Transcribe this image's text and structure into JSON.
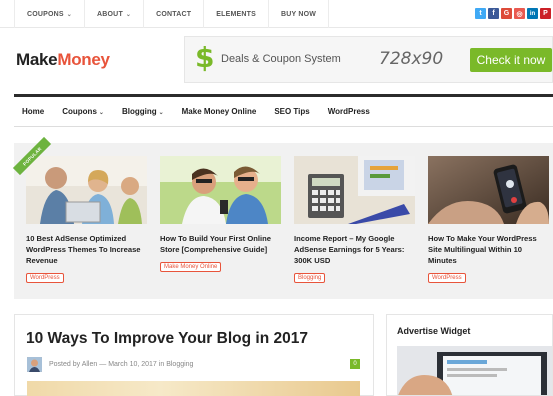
{
  "topbar": {
    "nav": [
      {
        "label": "COUPONS",
        "dropdown": true
      },
      {
        "label": "ABOUT",
        "dropdown": true
      },
      {
        "label": "CONTACT",
        "dropdown": false
      },
      {
        "label": "ELEMENTS",
        "dropdown": false
      },
      {
        "label": "BUY NOW",
        "dropdown": false
      }
    ],
    "social": [
      {
        "icon": "twitter-icon",
        "glyph": "t",
        "color": "#3fa9f5"
      },
      {
        "icon": "facebook-icon",
        "glyph": "f",
        "color": "#3b5998"
      },
      {
        "icon": "google-plus-icon",
        "glyph": "G",
        "color": "#dd4b39"
      },
      {
        "icon": "dribbble-icon",
        "glyph": "◎",
        "color": "#e95950"
      },
      {
        "icon": "linkedin-icon",
        "glyph": "in",
        "color": "#0077b5"
      },
      {
        "icon": "pinterest-icon",
        "glyph": "P",
        "color": "#cb2027"
      }
    ]
  },
  "header": {
    "logo_part1": "Make",
    "logo_part2": "Money",
    "ad": {
      "dollar": "$",
      "text": "Deals & Coupon System",
      "size": "728x90",
      "button": "Check it now"
    }
  },
  "main_nav": [
    {
      "label": "Home",
      "dropdown": false
    },
    {
      "label": "Coupons",
      "dropdown": true
    },
    {
      "label": "Blogging",
      "dropdown": true
    },
    {
      "label": "Make Money Online",
      "dropdown": false
    },
    {
      "label": "SEO Tips",
      "dropdown": false
    },
    {
      "label": "WordPress",
      "dropdown": false
    }
  ],
  "popular": {
    "ribbon": "POPULAR",
    "cards": [
      {
        "title": "10 Best AdSense Optimized WordPress Themes To Increase Revenue",
        "category": "WordPress"
      },
      {
        "title": "How To Build Your First Online Store [Comprehensive Guide]",
        "category": "Make Money Online"
      },
      {
        "title": "Income Report – My Google AdSense Earnings for 5 Years: 300K USD",
        "category": "Blogging"
      },
      {
        "title": "How To Make Your WordPress Site Multilingual Within 10 Minutes",
        "category": "WordPress"
      }
    ]
  },
  "post": {
    "title": "10 Ways To Improve Your Blog in 2017",
    "meta_prefix": "Posted by",
    "author": "Allen",
    "meta_sep": "—",
    "date": "March 10, 2017",
    "meta_in": "in",
    "category": "Blogging",
    "comments": "0"
  },
  "widget": {
    "title": "Advertise Widget"
  },
  "colors": {
    "accent": "#e8543b",
    "green": "#7ab929",
    "strip_bg": "#f1f1f1"
  }
}
